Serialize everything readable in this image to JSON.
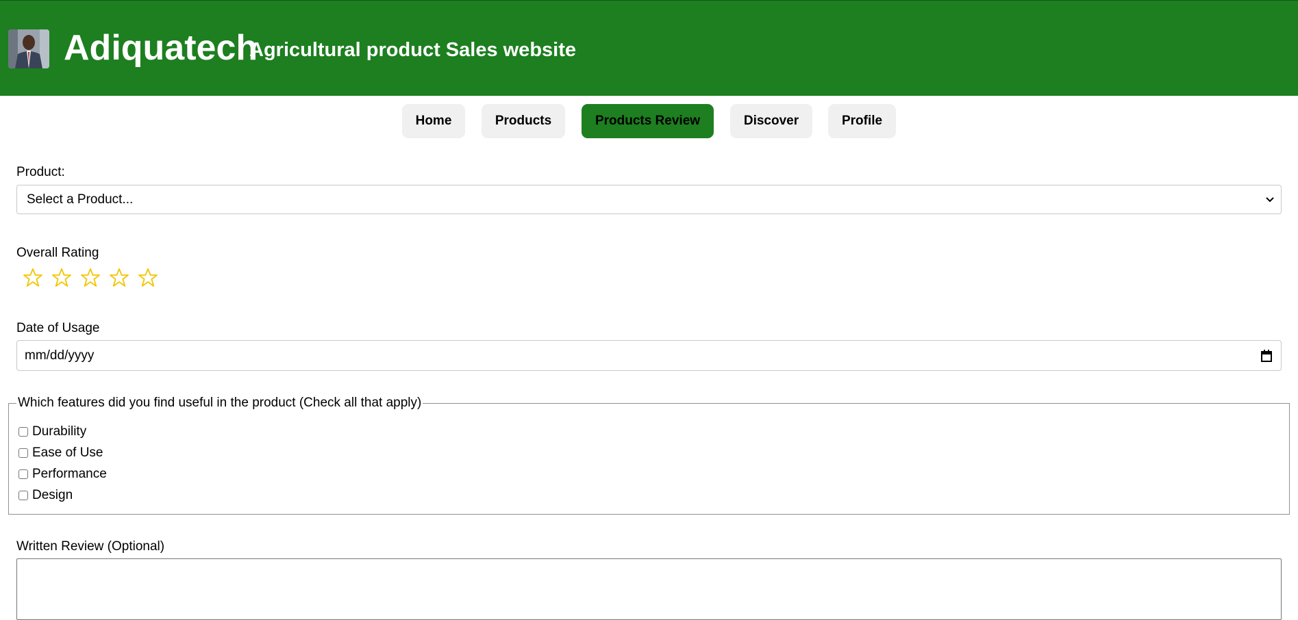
{
  "header": {
    "site_name": "Adiquatech",
    "tagline": "Agricultural product Sales website",
    "avatar_icon": "person-photo-icon"
  },
  "nav": {
    "items": [
      {
        "label": "Home",
        "active": false
      },
      {
        "label": "Products",
        "active": false
      },
      {
        "label": "Products Review",
        "active": true
      },
      {
        "label": "Discover",
        "active": false
      },
      {
        "label": "Profile",
        "active": false
      }
    ]
  },
  "form": {
    "product": {
      "label": "Product:",
      "selected": "Select a Product..."
    },
    "rating": {
      "label": "Overall Rating",
      "max_stars": 5,
      "value": 0
    },
    "date": {
      "label": "Date of Usage",
      "placeholder": "mm/dd/yyyy"
    },
    "features": {
      "legend": "Which features did you find useful in the product (Check all that apply)",
      "options": [
        {
          "label": "Durability",
          "checked": false
        },
        {
          "label": "Ease of Use",
          "checked": false
        },
        {
          "label": "Performance",
          "checked": false
        },
        {
          "label": "Design",
          "checked": false
        }
      ]
    },
    "review": {
      "label": "Written Review (Optional)",
      "value": ""
    }
  },
  "colors": {
    "brand_green": "#1d7f20",
    "star_gold": "#f2c500",
    "nav_inactive": "#f0f0f0"
  }
}
